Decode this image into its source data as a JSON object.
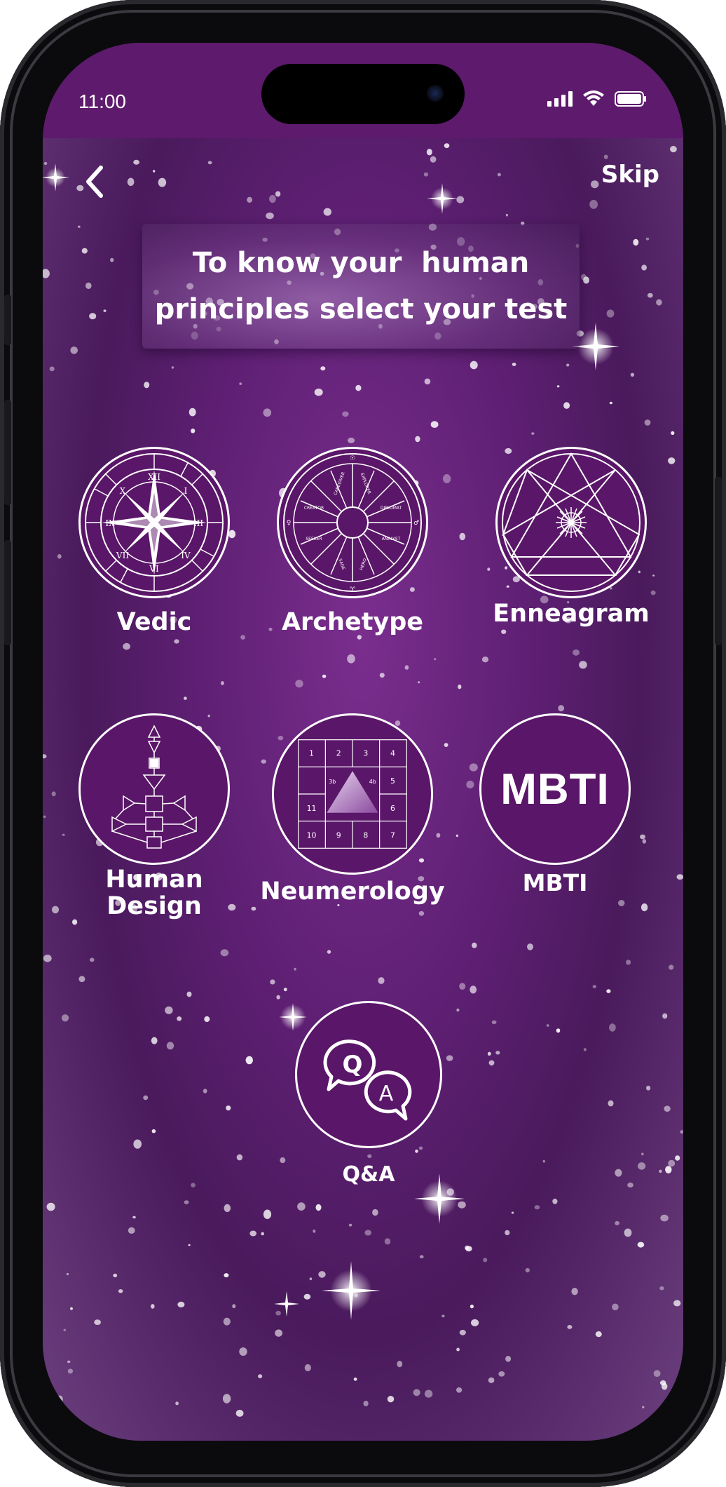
{
  "status_bar": {
    "time": "11:00",
    "signal_icon": "cellular-signal-icon",
    "wifi_icon": "wifi-icon",
    "battery_icon": "battery-icon"
  },
  "nav": {
    "back_icon": "chevron-left-icon",
    "skip_label": "Skip"
  },
  "banner": {
    "line1": "To know your  human",
    "line2": "principles select your test"
  },
  "tests": [
    {
      "label": "Vedic",
      "icon": "zodiac-compass-icon"
    },
    {
      "label": "Archetype",
      "icon": "archetype-wheel-icon"
    },
    {
      "label": "Enneagram",
      "icon": "enneagram-icon"
    },
    {
      "label_line1": "Human",
      "label_line2": "Design",
      "icon": "bodygraph-icon"
    },
    {
      "label": "Neumerology",
      "icon": "numerology-grid-icon",
      "grid": [
        "1",
        "2",
        "3",
        "4",
        "3b",
        "4b",
        "5",
        "11",
        "6",
        "10",
        "9",
        "8",
        "7"
      ]
    },
    {
      "label": "MBTI",
      "icon_text": "MBTI"
    },
    {
      "label": "Q&A",
      "icon": "qa-speech-bubbles-icon",
      "bubble_q": "Q",
      "bubble_a": "A"
    }
  ],
  "colors": {
    "status_bar": "#5e1a6d",
    "background_center": "#7a2e8e",
    "background_edge": "#4a1a5c",
    "circle_fill": "#5a1668",
    "text": "#ffffff"
  }
}
